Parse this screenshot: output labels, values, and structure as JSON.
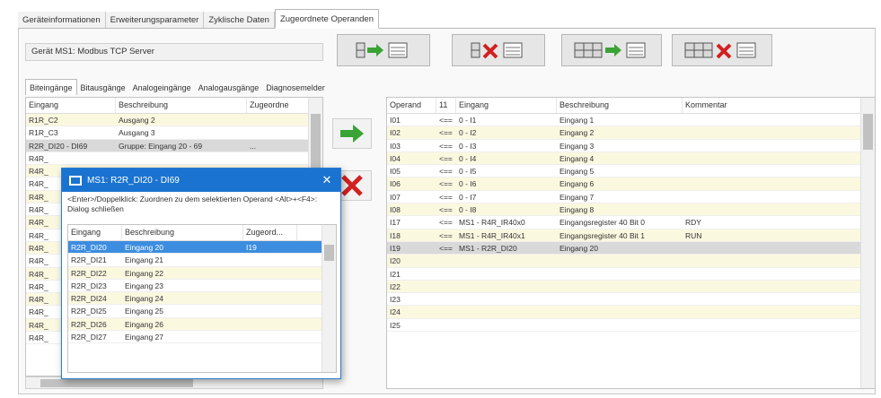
{
  "top_tabs": [
    "Geräteinformationen",
    "Erweiterungsparameter",
    "Zyklische Daten",
    "Zugeordnete Operanden"
  ],
  "device_label": "Gerät MS1: Modbus TCP Server",
  "sub_tabs": [
    "Biteingänge",
    "Bitausgänge",
    "Analogeingänge",
    "Analogausgänge",
    "Diagnosemelder"
  ],
  "left_table": {
    "headers": [
      "Eingang",
      "Beschreibung",
      "Zugeordne"
    ],
    "rows": [
      [
        "R1R_C2",
        "Ausgang 2",
        ""
      ],
      [
        "R1R_C3",
        "Ausgang 3",
        ""
      ],
      [
        "R2R_DI20 - DI69",
        "Gruppe: Eingang 20 - 69",
        "..."
      ],
      [
        "R4R_",
        "",
        ""
      ],
      [
        "R4R_",
        "",
        ""
      ],
      [
        "R4R_",
        "",
        ""
      ],
      [
        "R4R_",
        "",
        ""
      ],
      [
        "R4R_",
        "",
        ""
      ],
      [
        "R4R_",
        "",
        ""
      ],
      [
        "R4R_",
        "",
        ""
      ],
      [
        "R4R_",
        "",
        ""
      ],
      [
        "R4R_",
        "",
        ""
      ],
      [
        "R4R_",
        "",
        ""
      ],
      [
        "R4R_",
        "",
        ""
      ],
      [
        "R4R_",
        "",
        ""
      ],
      [
        "R4R_",
        "",
        ""
      ],
      [
        "R4R_",
        "",
        ""
      ],
      [
        "R4R_",
        "",
        ""
      ]
    ]
  },
  "right_table": {
    "headers": [
      "Operand",
      "11",
      "Eingang",
      "Beschreibung",
      "Kommentar"
    ],
    "rows": [
      [
        "I01",
        "<==",
        "0 - I1",
        "Eingang 1",
        ""
      ],
      [
        "I02",
        "<==",
        "0 - I2",
        "Eingang 2",
        ""
      ],
      [
        "I03",
        "<==",
        "0 - I3",
        "Eingang 3",
        ""
      ],
      [
        "I04",
        "<==",
        "0 - I4",
        "Eingang 4",
        ""
      ],
      [
        "I05",
        "<==",
        "0 - I5",
        "Eingang 5",
        ""
      ],
      [
        "I06",
        "<==",
        "0 - I6",
        "Eingang 6",
        ""
      ],
      [
        "I07",
        "<==",
        "0 - I7",
        "Eingang 7",
        ""
      ],
      [
        "I08",
        "<==",
        "0 - I8",
        "Eingang 8",
        ""
      ],
      [
        "I17",
        "<==",
        "MS1 - R4R_IR40x0",
        "Eingangsregister 40 Bit 0",
        "RDY"
      ],
      [
        "I18",
        "<==",
        "MS1 - R4R_IR40x1",
        "Eingangsregister 40 Bit 1",
        "RUN"
      ],
      [
        "I19",
        "<==",
        "MS1 - R2R_DI20",
        "Eingang 20",
        ""
      ],
      [
        "I20",
        "",
        "",
        "",
        ""
      ],
      [
        "I21",
        "",
        "",
        "",
        ""
      ],
      [
        "I22",
        "",
        "",
        "",
        ""
      ],
      [
        "I23",
        "",
        "",
        "",
        ""
      ],
      [
        "I24",
        "",
        "",
        "",
        ""
      ],
      [
        "I25",
        "",
        "",
        "",
        ""
      ]
    ]
  },
  "dialog": {
    "title": "MS1: R2R_DI20 - DI69",
    "close": "✕",
    "info": "<Enter>/Doppelklick: Zuordnen zu dem selektierten Operand <Alt>+<F4>: Dialog schließen",
    "headers": [
      "Eingang",
      "Beschreibung",
      "Zugeord..."
    ],
    "rows": [
      [
        "R2R_DI20",
        "Eingang 20",
        "I19"
      ],
      [
        "R2R_DI21",
        "Eingang 21",
        ""
      ],
      [
        "R2R_DI22",
        "Eingang 22",
        ""
      ],
      [
        "R2R_DI23",
        "Eingang 23",
        ""
      ],
      [
        "R2R_DI24",
        "Eingang 24",
        ""
      ],
      [
        "R2R_DI25",
        "Eingang 25",
        ""
      ],
      [
        "R2R_DI26",
        "Eingang 26",
        ""
      ],
      [
        "R2R_DI27",
        "Eingang 27",
        ""
      ]
    ]
  },
  "colors": {
    "accent": "#1a73d0",
    "row_yellow": "#fbf8e0",
    "selected": "#3c8de0",
    "arrow_green": "#3aa335",
    "x_red": "#d22020"
  }
}
